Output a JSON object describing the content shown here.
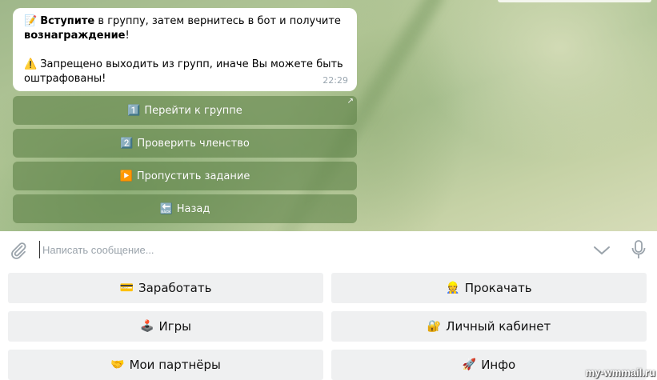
{
  "message": {
    "line1_bold": "Вступите",
    "line1_rest": " в группу, затем вернитесь в бот и получите",
    "line2_bold": "вознаграждение",
    "line2_rest": "!",
    "line3": "Запрещено выходить из групп, иначе Вы можете быть",
    "line4": "оштрафованы!",
    "time": "22:29",
    "icons": [
      "memo-icon",
      "warning-icon"
    ]
  },
  "inline_buttons": [
    {
      "icon": "keycap-1",
      "glyph": "1️⃣",
      "label": "Перейти к группе",
      "has_link_arrow": true
    },
    {
      "icon": "keycap-2",
      "glyph": "2️⃣",
      "label": "Проверить членство"
    },
    {
      "icon": "play-icon",
      "glyph": "▶️",
      "label": "Пропустить задание"
    },
    {
      "icon": "back-arrow-icon",
      "glyph": "🔙",
      "label": "Назад"
    }
  ],
  "input": {
    "placeholder": "Написать сообщение..."
  },
  "reply_keyboard": [
    {
      "icon": "credit-card-icon",
      "glyph": "💳",
      "label": "Заработать"
    },
    {
      "icon": "construction-worker-icon",
      "glyph": "👷",
      "label": "Прокачать"
    },
    {
      "icon": "joystick-icon",
      "glyph": "🕹️",
      "label": "Игры"
    },
    {
      "icon": "lock-key-icon",
      "glyph": "🔐",
      "label": "Личный кабинет"
    },
    {
      "icon": "handshake-icon",
      "glyph": "🤝",
      "label": "Мои партнёры"
    },
    {
      "icon": "rocket-icon",
      "glyph": "🚀",
      "label": "Инфо"
    }
  ],
  "watermark": "my-wmmail.ru",
  "colors": {
    "inline_button_bg": "#60824880",
    "reply_button_bg": "#eff0f1",
    "time_text": "#9aa6b0"
  }
}
